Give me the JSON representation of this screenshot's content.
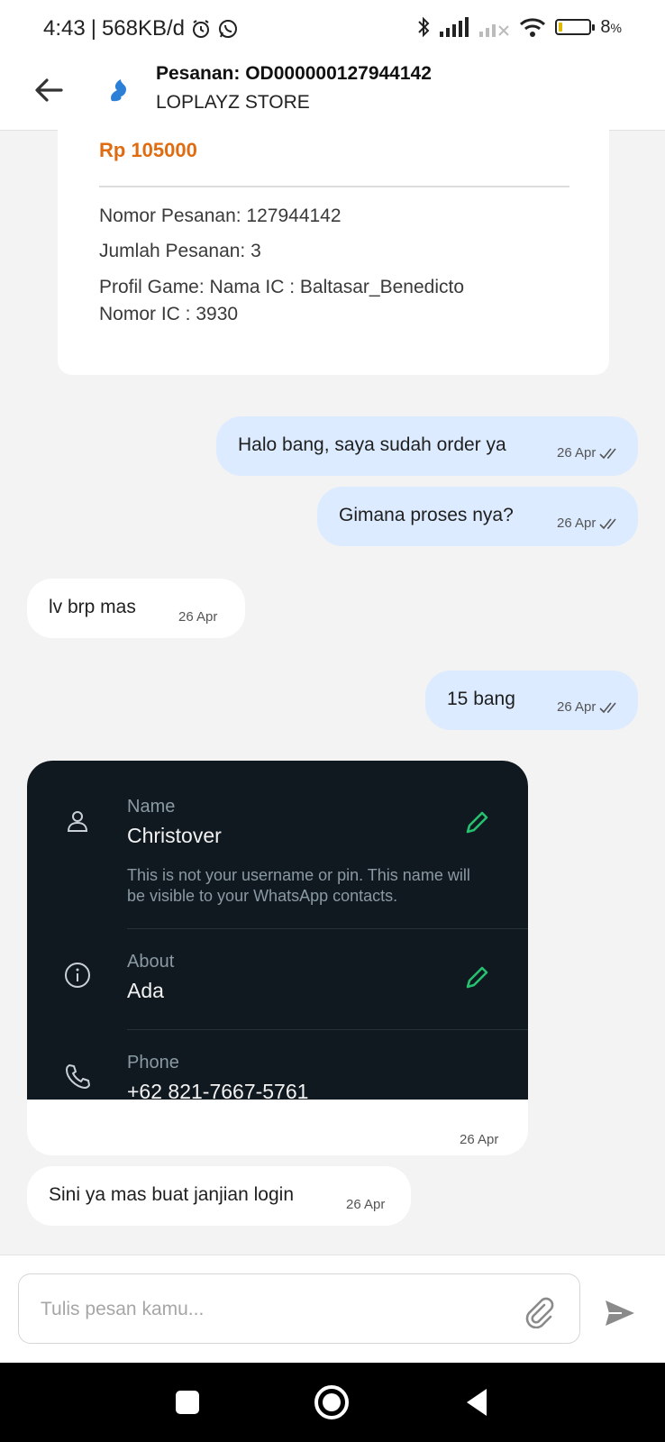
{
  "status_bar": {
    "time": "4:43",
    "data_rate": "568KB/d",
    "battery": "8",
    "battery_unit": "%",
    "battery_level_fraction": 0.08,
    "icons": [
      "alarm-icon",
      "whatsapp-icon",
      "bluetooth-icon",
      "signal-icon",
      "signal-off-icon",
      "wifi-icon",
      "battery-icon"
    ]
  },
  "header": {
    "title": "Pesanan: OD000000127944142",
    "subtitle": "LOPLAYZ STORE"
  },
  "order_card": {
    "price": "Rp 105000",
    "order_number": "Nomor Pesanan: 127944142",
    "quantity": "Jumlah Pesanan: 3",
    "game_profile_line1": "Profil Game: Nama IC : Baltasar_Benedicto",
    "game_profile_line2": "Nomor IC : 3930"
  },
  "messages": [
    {
      "direction": "out",
      "text": "Halo bang, saya sudah order ya",
      "time": "26 Apr",
      "status": "read"
    },
    {
      "direction": "out",
      "text": "Gimana proses nya?",
      "time": "26 Apr",
      "status": "read"
    },
    {
      "direction": "in",
      "text": "lv brp mas",
      "time": "26 Apr"
    },
    {
      "direction": "out",
      "text": "15 bang",
      "time": "26 Apr",
      "status": "read"
    },
    {
      "direction": "in",
      "type": "image",
      "time": "26 Apr"
    },
    {
      "direction": "in",
      "text": "Sini ya mas buat janjian login",
      "time": "26 Apr"
    }
  ],
  "image_content": {
    "name_label": "Name",
    "name_value": "Christover",
    "name_hint": "This is not your username or pin. This name will be visible to your WhatsApp contacts.",
    "about_label": "About",
    "about_value": "Ada",
    "phone_label": "Phone",
    "phone_value": "+62 821-7667-5761"
  },
  "composer": {
    "placeholder": "Tulis pesan kamu..."
  },
  "colors": {
    "price": "#e06c12",
    "outgoing_bubble": "#dcebff",
    "incoming_bubble": "#ffffff",
    "background": "#f3f3f3",
    "whatsapp_green": "#25c16f"
  }
}
